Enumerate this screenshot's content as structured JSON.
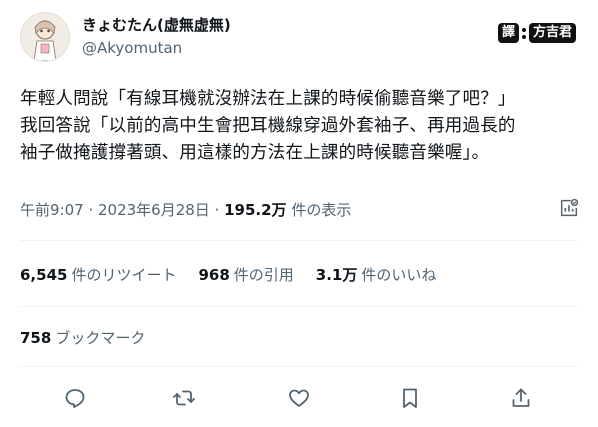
{
  "author": {
    "display_name": "きょむたん(虚無虚無)",
    "handle": "@Akyomutan",
    "avatar_icon": "avatar-icon"
  },
  "watermark": {
    "badge": "譯",
    "text": "方吉君"
  },
  "tweet": {
    "lines": [
      "年輕人問說「有線耳機就沒辦法在上課的時候偷聽音樂了吧？」",
      "我回答說「以前的高中生會把耳機線穿過外套袖子、再用過長的",
      "袖子做掩護撐著頭、用這樣的方法在上課的時候聽音樂喔」。"
    ]
  },
  "meta": {
    "time_date": "午前9:07 · 2023年6月28日 · ",
    "views_count": "195.2万",
    "views_label": " 件の表示"
  },
  "stats": {
    "retweets_count": "6,545",
    "retweets_label": "件のリツイート",
    "quotes_count": "968",
    "quotes_label": "件の引用",
    "likes_count": "3.1万",
    "likes_label": "件のいいね"
  },
  "bookmarks": {
    "count": "758",
    "label": "ブックマーク"
  },
  "colors": {
    "text": "#0f1419",
    "secondary": "#536471",
    "divider": "#eff3f4"
  },
  "actions": [
    "reply-icon",
    "retweet-icon",
    "like-icon",
    "bookmark-icon",
    "share-icon"
  ]
}
